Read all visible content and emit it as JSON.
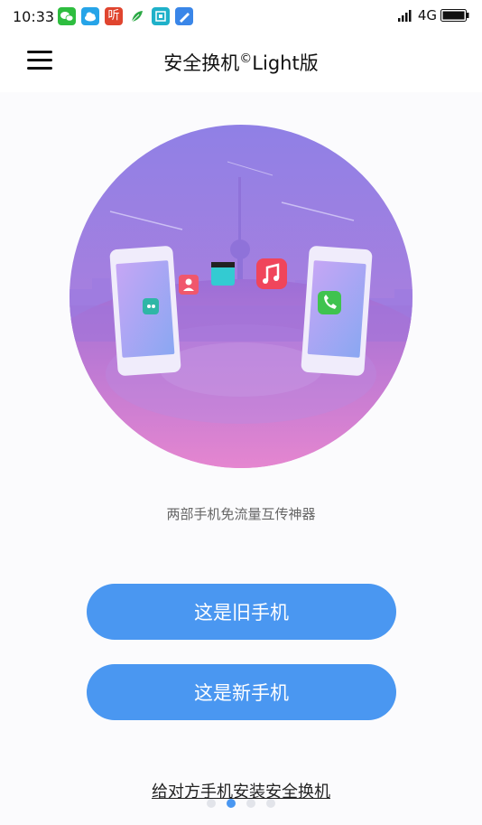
{
  "status_bar": {
    "time": "10:33",
    "network": "4G",
    "apps": [
      {
        "icon": "wechat-icon",
        "color": "#2ebd3f"
      },
      {
        "icon": "weather-icon",
        "color": "#26a4e8"
      },
      {
        "icon": "listen-icon",
        "color": "#e0452f",
        "label": "听"
      },
      {
        "icon": "leaf-icon",
        "color": "#2aa844"
      },
      {
        "icon": "scan-icon",
        "color": "#1fb1c9"
      },
      {
        "icon": "cleaner-icon",
        "color": "#3a86e8"
      }
    ]
  },
  "header": {
    "title_main": "安全换机",
    "title_mark": "©",
    "title_suffix": "Light版"
  },
  "main": {
    "subtitle": "两部手机免流量互传神器",
    "old_phone_button": "这是旧手机",
    "new_phone_button": "这是新手机",
    "install_link": "给对方手机安装安全换机"
  },
  "pagination": {
    "count": 4,
    "active": 1
  },
  "colors": {
    "accent": "#4a97f1",
    "illustration_top": "#8e80e6",
    "illustration_bottom": "#ee8ad1"
  }
}
